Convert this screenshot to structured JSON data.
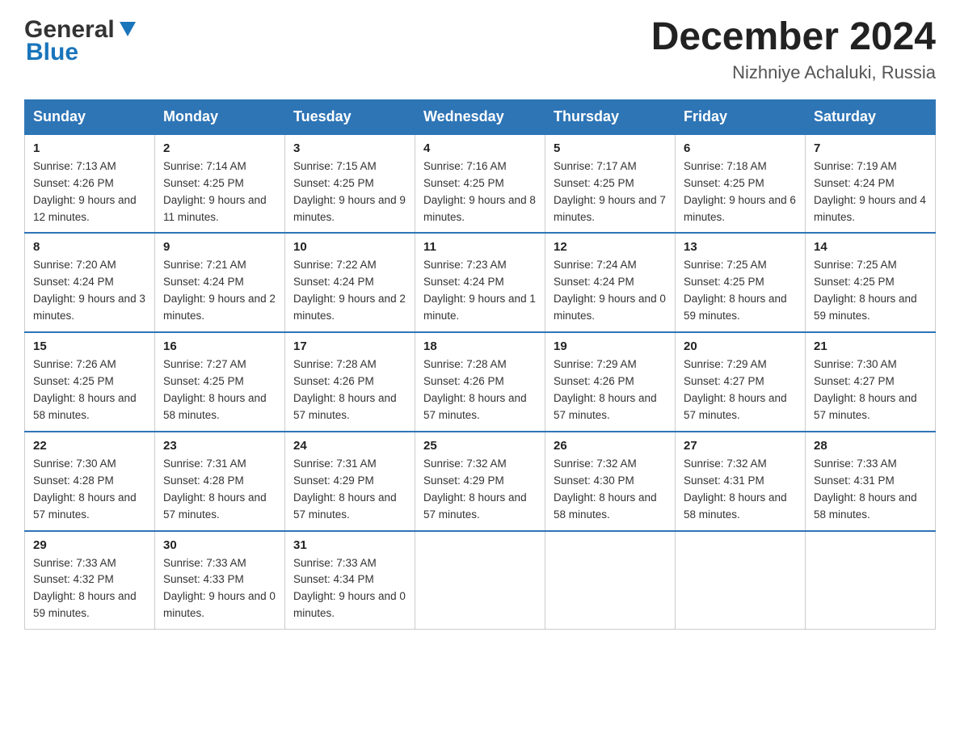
{
  "logo": {
    "general": "General",
    "blue": "Blue"
  },
  "title": "December 2024",
  "location": "Nizhniye Achaluki, Russia",
  "days_of_week": [
    "Sunday",
    "Monday",
    "Tuesday",
    "Wednesday",
    "Thursday",
    "Friday",
    "Saturday"
  ],
  "weeks": [
    [
      {
        "day": "1",
        "sunrise": "7:13 AM",
        "sunset": "4:26 PM",
        "daylight": "9 hours and 12 minutes."
      },
      {
        "day": "2",
        "sunrise": "7:14 AM",
        "sunset": "4:25 PM",
        "daylight": "9 hours and 11 minutes."
      },
      {
        "day": "3",
        "sunrise": "7:15 AM",
        "sunset": "4:25 PM",
        "daylight": "9 hours and 9 minutes."
      },
      {
        "day": "4",
        "sunrise": "7:16 AM",
        "sunset": "4:25 PM",
        "daylight": "9 hours and 8 minutes."
      },
      {
        "day": "5",
        "sunrise": "7:17 AM",
        "sunset": "4:25 PM",
        "daylight": "9 hours and 7 minutes."
      },
      {
        "day": "6",
        "sunrise": "7:18 AM",
        "sunset": "4:25 PM",
        "daylight": "9 hours and 6 minutes."
      },
      {
        "day": "7",
        "sunrise": "7:19 AM",
        "sunset": "4:24 PM",
        "daylight": "9 hours and 4 minutes."
      }
    ],
    [
      {
        "day": "8",
        "sunrise": "7:20 AM",
        "sunset": "4:24 PM",
        "daylight": "9 hours and 3 minutes."
      },
      {
        "day": "9",
        "sunrise": "7:21 AM",
        "sunset": "4:24 PM",
        "daylight": "9 hours and 2 minutes."
      },
      {
        "day": "10",
        "sunrise": "7:22 AM",
        "sunset": "4:24 PM",
        "daylight": "9 hours and 2 minutes."
      },
      {
        "day": "11",
        "sunrise": "7:23 AM",
        "sunset": "4:24 PM",
        "daylight": "9 hours and 1 minute."
      },
      {
        "day": "12",
        "sunrise": "7:24 AM",
        "sunset": "4:24 PM",
        "daylight": "9 hours and 0 minutes."
      },
      {
        "day": "13",
        "sunrise": "7:25 AM",
        "sunset": "4:25 PM",
        "daylight": "8 hours and 59 minutes."
      },
      {
        "day": "14",
        "sunrise": "7:25 AM",
        "sunset": "4:25 PM",
        "daylight": "8 hours and 59 minutes."
      }
    ],
    [
      {
        "day": "15",
        "sunrise": "7:26 AM",
        "sunset": "4:25 PM",
        "daylight": "8 hours and 58 minutes."
      },
      {
        "day": "16",
        "sunrise": "7:27 AM",
        "sunset": "4:25 PM",
        "daylight": "8 hours and 58 minutes."
      },
      {
        "day": "17",
        "sunrise": "7:28 AM",
        "sunset": "4:26 PM",
        "daylight": "8 hours and 57 minutes."
      },
      {
        "day": "18",
        "sunrise": "7:28 AM",
        "sunset": "4:26 PM",
        "daylight": "8 hours and 57 minutes."
      },
      {
        "day": "19",
        "sunrise": "7:29 AM",
        "sunset": "4:26 PM",
        "daylight": "8 hours and 57 minutes."
      },
      {
        "day": "20",
        "sunrise": "7:29 AM",
        "sunset": "4:27 PM",
        "daylight": "8 hours and 57 minutes."
      },
      {
        "day": "21",
        "sunrise": "7:30 AM",
        "sunset": "4:27 PM",
        "daylight": "8 hours and 57 minutes."
      }
    ],
    [
      {
        "day": "22",
        "sunrise": "7:30 AM",
        "sunset": "4:28 PM",
        "daylight": "8 hours and 57 minutes."
      },
      {
        "day": "23",
        "sunrise": "7:31 AM",
        "sunset": "4:28 PM",
        "daylight": "8 hours and 57 minutes."
      },
      {
        "day": "24",
        "sunrise": "7:31 AM",
        "sunset": "4:29 PM",
        "daylight": "8 hours and 57 minutes."
      },
      {
        "day": "25",
        "sunrise": "7:32 AM",
        "sunset": "4:29 PM",
        "daylight": "8 hours and 57 minutes."
      },
      {
        "day": "26",
        "sunrise": "7:32 AM",
        "sunset": "4:30 PM",
        "daylight": "8 hours and 58 minutes."
      },
      {
        "day": "27",
        "sunrise": "7:32 AM",
        "sunset": "4:31 PM",
        "daylight": "8 hours and 58 minutes."
      },
      {
        "day": "28",
        "sunrise": "7:33 AM",
        "sunset": "4:31 PM",
        "daylight": "8 hours and 58 minutes."
      }
    ],
    [
      {
        "day": "29",
        "sunrise": "7:33 AM",
        "sunset": "4:32 PM",
        "daylight": "8 hours and 59 minutes."
      },
      {
        "day": "30",
        "sunrise": "7:33 AM",
        "sunset": "4:33 PM",
        "daylight": "9 hours and 0 minutes."
      },
      {
        "day": "31",
        "sunrise": "7:33 AM",
        "sunset": "4:34 PM",
        "daylight": "9 hours and 0 minutes."
      },
      null,
      null,
      null,
      null
    ]
  ],
  "labels": {
    "sunrise": "Sunrise:",
    "sunset": "Sunset:",
    "daylight": "Daylight:"
  }
}
